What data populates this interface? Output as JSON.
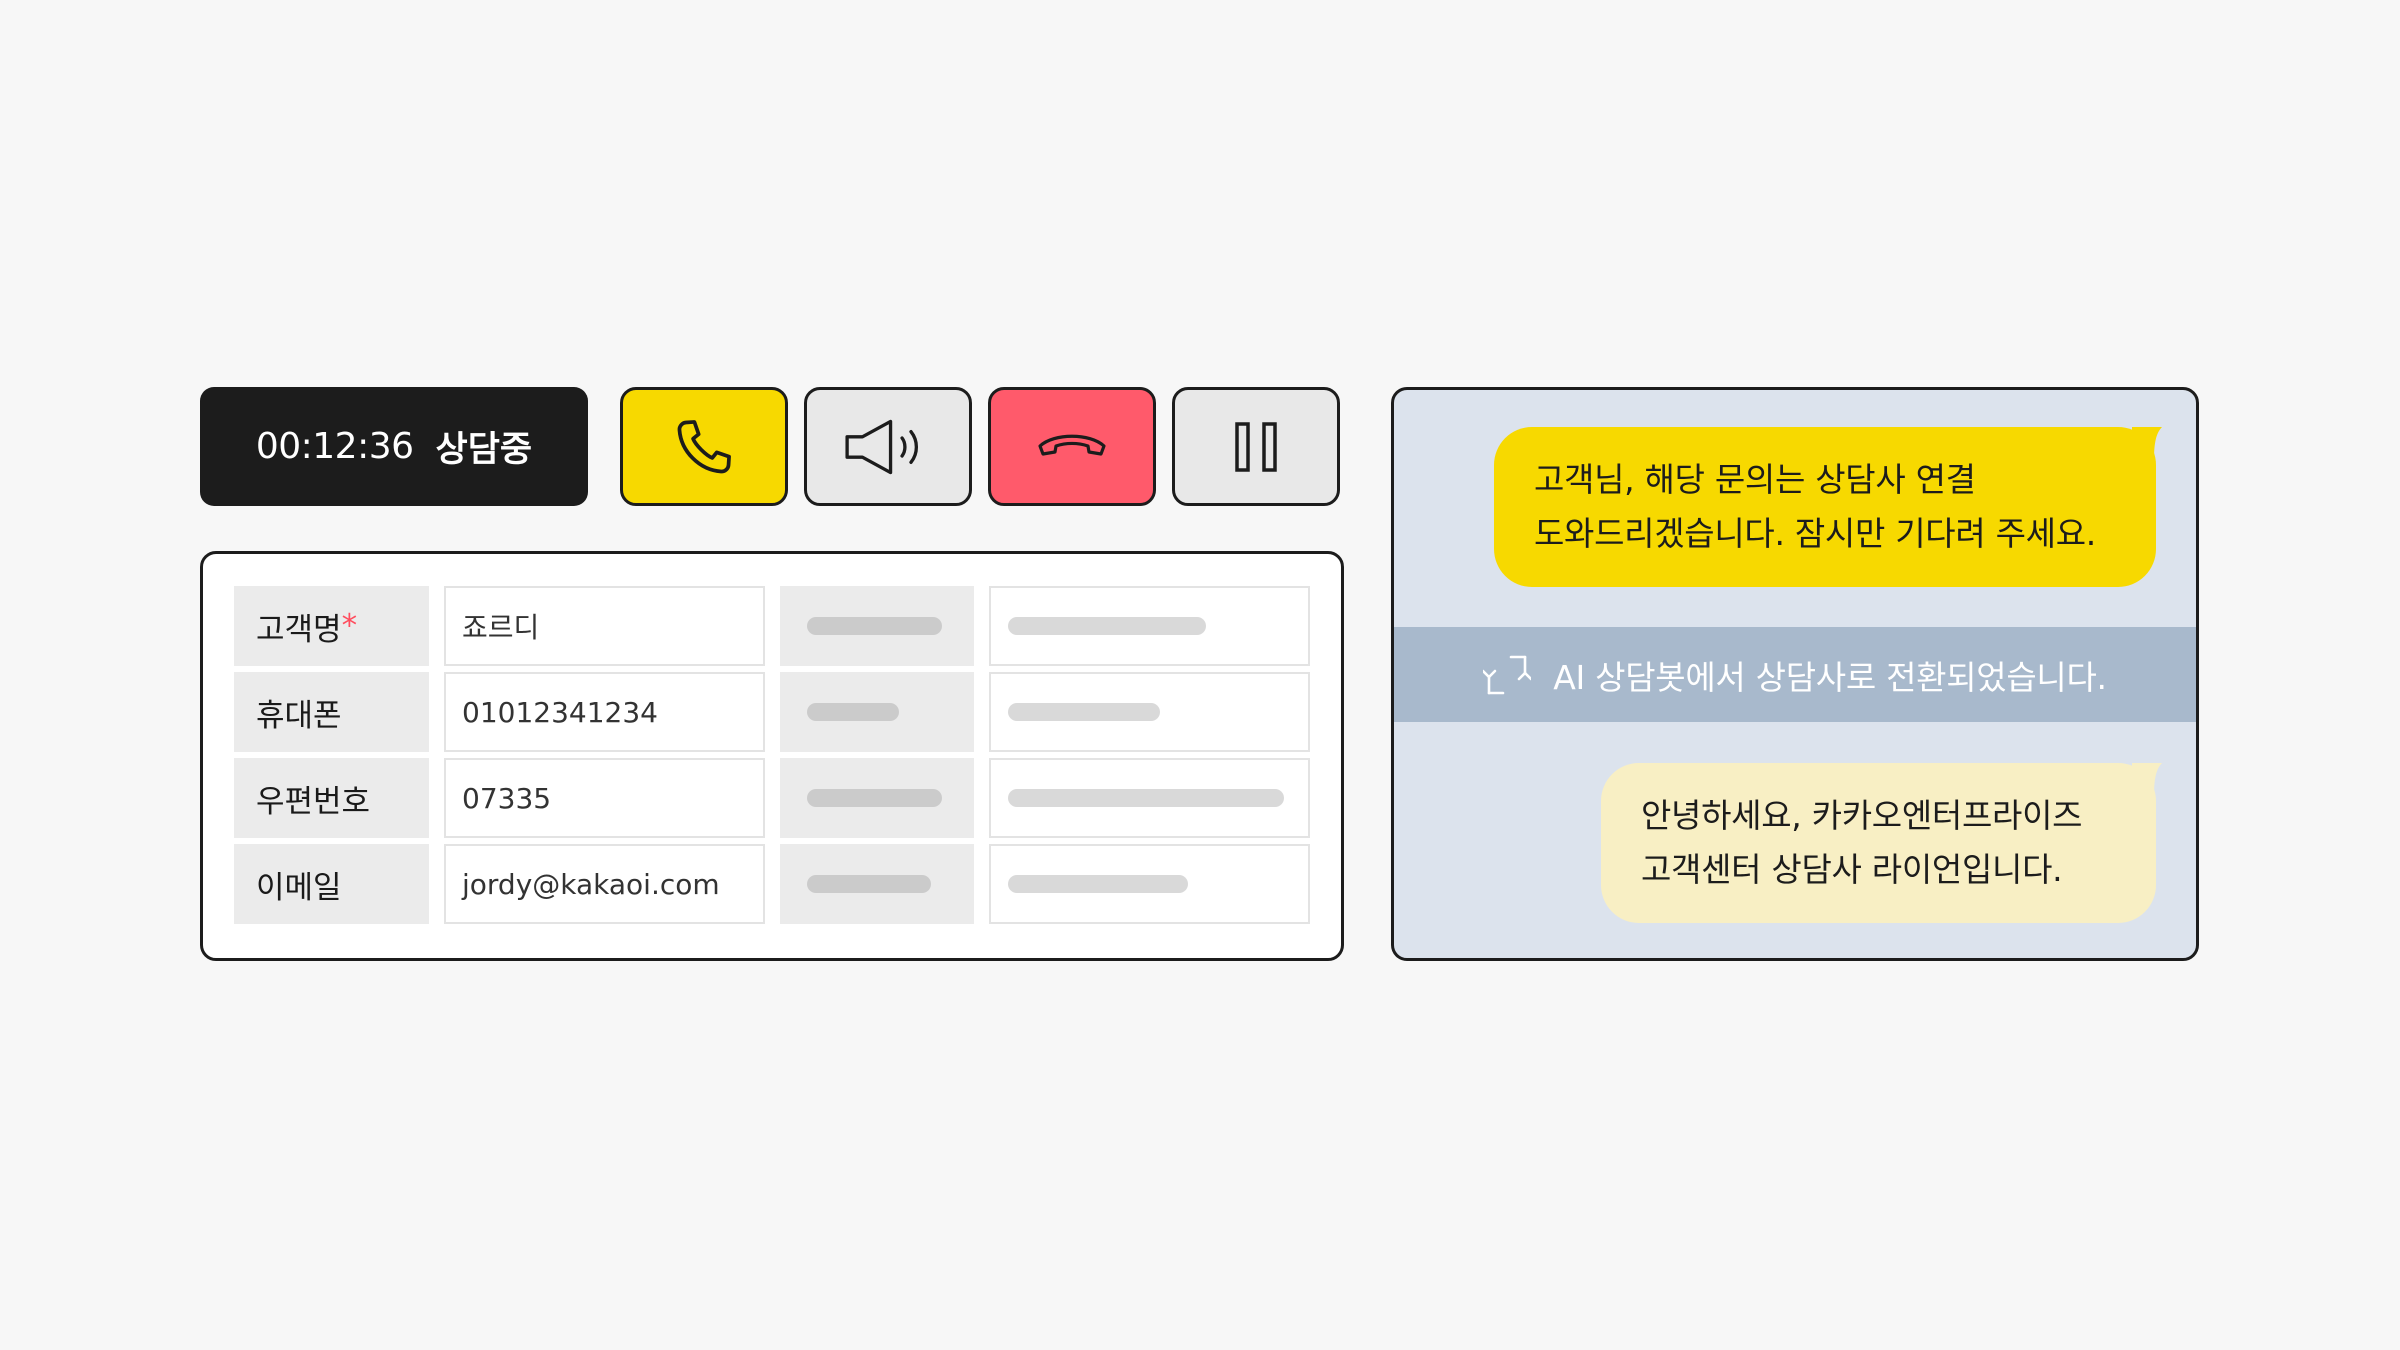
{
  "call_bar": {
    "timer": "00:12:36",
    "status": "상담중",
    "buttons": [
      {
        "icon": "phone-icon",
        "color": "#f7d900"
      },
      {
        "icon": "speaker-icon",
        "color": "#e8e8e8"
      },
      {
        "icon": "hang-up-icon",
        "color": "#ff5a6b"
      },
      {
        "icon": "pause-icon",
        "color": "#e8e8e8"
      }
    ]
  },
  "customer_form": {
    "fields": [
      {
        "label": "고객명",
        "required_mark": "*",
        "value": "죠르디"
      },
      {
        "label": "휴대폰",
        "value": "01012341234"
      },
      {
        "label": "우편번호",
        "value": "07335"
      },
      {
        "label": "이메일",
        "value": "jordy@kakaoi.com"
      }
    ]
  },
  "chat": {
    "ai_message": {
      "lines": [
        "고객님, 해당 문의는 상담사 연결",
        "도와드리겠습니다. 잠시만 기다려 주세요."
      ],
      "color": "#f7d900"
    },
    "transfer_notice": {
      "icon": "transfer-arrows-icon",
      "text": "AI 상담봇에서 상담사로 전환되었습니다."
    },
    "agent_message": {
      "lines": [
        "안녕하세요, 카카오엔터프라이즈",
        "고객센터 상담사 라이언입니다."
      ],
      "color": "#f8efc4"
    }
  },
  "colors": {
    "background": "#f7f7f7",
    "accent_yellow": "#f7d900",
    "hangup_red": "#ff5a6b",
    "chat_background": "#dce3ed",
    "transfer_bar": "#a8b9cc"
  }
}
